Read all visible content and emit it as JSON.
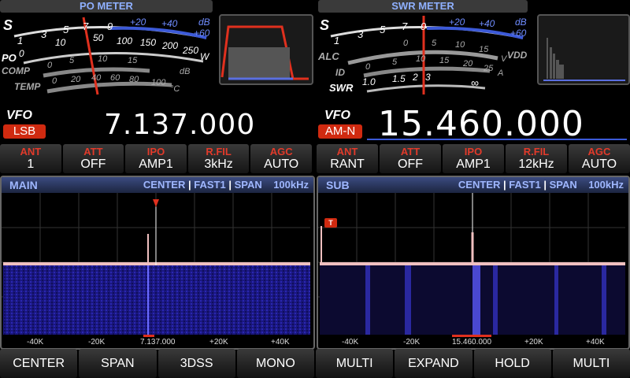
{
  "left": {
    "meter_title": "PO METER",
    "meter": {
      "s_label": "S",
      "s_scale": [
        "1",
        "3",
        "5",
        "7",
        "9"
      ],
      "s_db": [
        "+20",
        "+40",
        "dB",
        "+60"
      ],
      "po_label": "PO",
      "po_scale": [
        "0",
        "10",
        "50",
        "100",
        "150",
        "200",
        "250"
      ],
      "po_unit": "W",
      "comp_label": "COMP",
      "comp_scale": [
        "0",
        "5",
        "10",
        "15"
      ],
      "comp_unit": "dB",
      "temp_label": "TEMP",
      "temp_scale": [
        "0",
        "20",
        "40",
        "60",
        "80",
        "100"
      ],
      "temp_unit": "°C"
    },
    "vfo": "VFO",
    "mode": "LSB",
    "frequency": "7.137.000",
    "params": [
      {
        "title": "ANT",
        "value": "1"
      },
      {
        "title": "ATT",
        "value": "OFF"
      },
      {
        "title": "IPO",
        "value": "AMP1"
      },
      {
        "title": "R.FIL",
        "value": "3kHz"
      },
      {
        "title": "AGC",
        "value": "AUTO"
      }
    ],
    "scope": {
      "name": "MAIN",
      "center": "CENTER",
      "speed": "FAST1",
      "span_label": "SPAN",
      "span": "100kHz",
      "ticks": [
        "-40K",
        "-20K",
        "7.137.000",
        "+20K",
        "+40K"
      ]
    }
  },
  "right": {
    "meter_title": "SWR METER",
    "meter": {
      "s_label": "S",
      "s_scale": [
        "1",
        "3",
        "5",
        "7",
        "9"
      ],
      "s_db": [
        "+20",
        "+40",
        "dB",
        "+60"
      ],
      "alc_label": "ALC",
      "vdd_scale": [
        "0",
        "5",
        "10",
        "15"
      ],
      "vdd_label": "VDD",
      "vdd_unit": "V",
      "id_label": "ID",
      "id_scale": [
        "0",
        "5",
        "10",
        "15",
        "20",
        "25"
      ],
      "id_unit": "A",
      "swr_label": "SWR",
      "swr_scale": [
        "1.0",
        "1.5",
        "2",
        "3",
        "∞"
      ]
    },
    "vfo": "VFO",
    "mode": "AM-N",
    "frequency": "15.460.000",
    "params": [
      {
        "title": "ANT",
        "value": "RANT"
      },
      {
        "title": "ATT",
        "value": "OFF"
      },
      {
        "title": "IPO",
        "value": "AMP1"
      },
      {
        "title": "R.FIL",
        "value": "12kHz"
      },
      {
        "title": "AGC",
        "value": "AUTO"
      }
    ],
    "scope": {
      "name": "SUB",
      "center": "CENTER",
      "speed": "FAST1",
      "span_label": "SPAN",
      "span": "100kHz",
      "marker": "T",
      "ticks": [
        "-40K",
        "-20K",
        "15.460.000",
        "+20K",
        "+40K"
      ]
    }
  },
  "bottom_buttons": [
    "CENTER",
    "SPAN",
    "3DSS",
    "MONO",
    "MULTI",
    "EXPAND",
    "HOLD",
    "MULTI"
  ],
  "colors": {
    "accent_red": "#d02a10",
    "meter_blue": "#3c5ad8",
    "needle": "#e0301e",
    "waterfall_bg": "#16136e"
  }
}
